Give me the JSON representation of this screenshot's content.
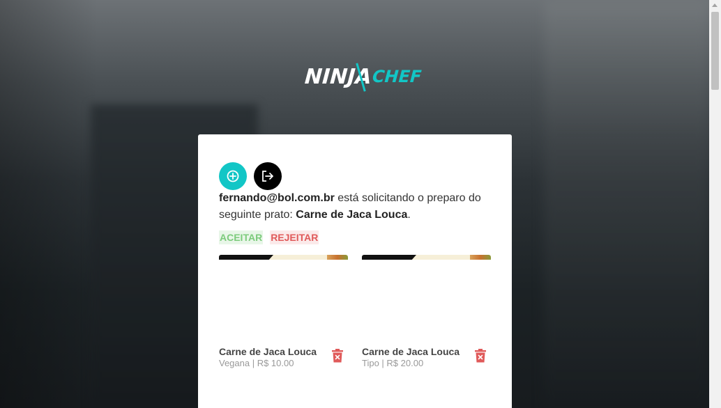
{
  "brand": {
    "part1": "NINJA",
    "part2": "CHEF",
    "accent_color": "#12c6c6"
  },
  "toolbar": {
    "add_icon": "plus-circle-icon",
    "logout_icon": "logout-icon"
  },
  "request": {
    "email": "fernando@bol.com.br",
    "text_middle": " está solicitando o preparo do seguinte prato: ",
    "dish": "Carne de Jaca Louca",
    "text_end": "."
  },
  "actions": {
    "accept": "ACEITAR",
    "reject": "REJEITAR"
  },
  "dishes": [
    {
      "name": "Carne de Jaca Louca",
      "meta": "Vegana | R$ 10.00",
      "delete_icon": "trash-icon"
    },
    {
      "name": "Carne de Jaca Louca",
      "meta": "Tipo | R$ 20.00",
      "delete_icon": "trash-icon"
    }
  ]
}
